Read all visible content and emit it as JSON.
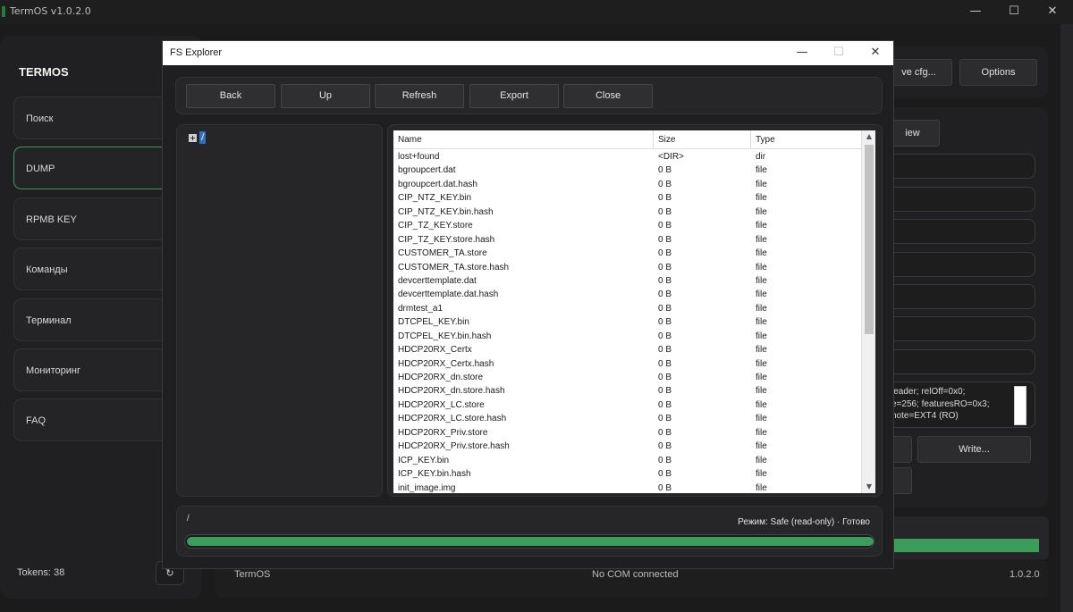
{
  "window": {
    "title": "TermOS v1.0.2.0",
    "minimize": "—",
    "maximize": "☐",
    "close": "✕"
  },
  "sidebar": {
    "brand": "TERMOS",
    "items": [
      {
        "label": "Поиск",
        "active": false
      },
      {
        "label": "DUMP",
        "active": true
      },
      {
        "label": "RPMB KEY",
        "active": false
      },
      {
        "label": "Команды",
        "active": false
      },
      {
        "label": "Терминал",
        "active": false
      },
      {
        "label": "Мониторинг",
        "active": false
      },
      {
        "label": "FAQ",
        "active": false
      }
    ],
    "tokens": "Tokens: 38",
    "refresh_glyph": "↻"
  },
  "background": {
    "save_cfg_label": "ve cfg...",
    "options_label": "Options",
    "view_label": "iew",
    "write_label": "Write...",
    "info_lines": "leader; relOff=0x0;\ne=256; featuresRO=0x3;\nnote=EXT4 (RO)"
  },
  "statusbar": {
    "left": "TermOS",
    "center": "No COM connected",
    "right": "1.0.2.0"
  },
  "dialog": {
    "title": "FS Explorer",
    "minimize": "—",
    "maximize": "☐",
    "close": "✕",
    "toolbar": {
      "back": "Back",
      "up": "Up",
      "refresh": "Refresh",
      "export": "Export",
      "close": "Close"
    },
    "tree": {
      "expander": "+",
      "root": "/"
    },
    "columns": {
      "name": "Name",
      "size": "Size",
      "type": "Type"
    },
    "rows": [
      {
        "name": "lost+found",
        "size": "<DIR>",
        "type": "dir"
      },
      {
        "name": "bgroupcert.dat",
        "size": "0 B",
        "type": "file"
      },
      {
        "name": "bgroupcert.dat.hash",
        "size": "0 B",
        "type": "file"
      },
      {
        "name": "CIP_NTZ_KEY.bin",
        "size": "0 B",
        "type": "file"
      },
      {
        "name": "CIP_NTZ_KEY.bin.hash",
        "size": "0 B",
        "type": "file"
      },
      {
        "name": "CIP_TZ_KEY.store",
        "size": "0 B",
        "type": "file"
      },
      {
        "name": "CIP_TZ_KEY.store.hash",
        "size": "0 B",
        "type": "file"
      },
      {
        "name": "CUSTOMER_TA.store",
        "size": "0 B",
        "type": "file"
      },
      {
        "name": "CUSTOMER_TA.store.hash",
        "size": "0 B",
        "type": "file"
      },
      {
        "name": "devcerttemplate.dat",
        "size": "0 B",
        "type": "file"
      },
      {
        "name": "devcerttemplate.dat.hash",
        "size": "0 B",
        "type": "file"
      },
      {
        "name": "drmtest_a1",
        "size": "0 B",
        "type": "file"
      },
      {
        "name": "DTCPEL_KEY.bin",
        "size": "0 B",
        "type": "file"
      },
      {
        "name": "DTCPEL_KEY.bin.hash",
        "size": "0 B",
        "type": "file"
      },
      {
        "name": "HDCP20RX_Certx",
        "size": "0 B",
        "type": "file"
      },
      {
        "name": "HDCP20RX_Certx.hash",
        "size": "0 B",
        "type": "file"
      },
      {
        "name": "HDCP20RX_dn.store",
        "size": "0 B",
        "type": "file"
      },
      {
        "name": "HDCP20RX_dn.store.hash",
        "size": "0 B",
        "type": "file"
      },
      {
        "name": "HDCP20RX_LC.store",
        "size": "0 B",
        "type": "file"
      },
      {
        "name": "HDCP20RX_LC.store.hash",
        "size": "0 B",
        "type": "file"
      },
      {
        "name": "HDCP20RX_Priv.store",
        "size": "0 B",
        "type": "file"
      },
      {
        "name": "HDCP20RX_Priv.store.hash",
        "size": "0 B",
        "type": "file"
      },
      {
        "name": "ICP_KEY.bin",
        "size": "0 B",
        "type": "file"
      },
      {
        "name": "ICP_KEY.bin.hash",
        "size": "0 B",
        "type": "file"
      },
      {
        "name": "init_image.img",
        "size": "0 B",
        "type": "file"
      }
    ],
    "scroll_up": "▲",
    "scroll_down": "▼",
    "current_path": "/",
    "mode_status": "Режим: Safe (read-only) · Готово",
    "progress": 1.0
  },
  "colors": {
    "accent": "#3a9d5b",
    "selection": "#2f6fc9"
  }
}
